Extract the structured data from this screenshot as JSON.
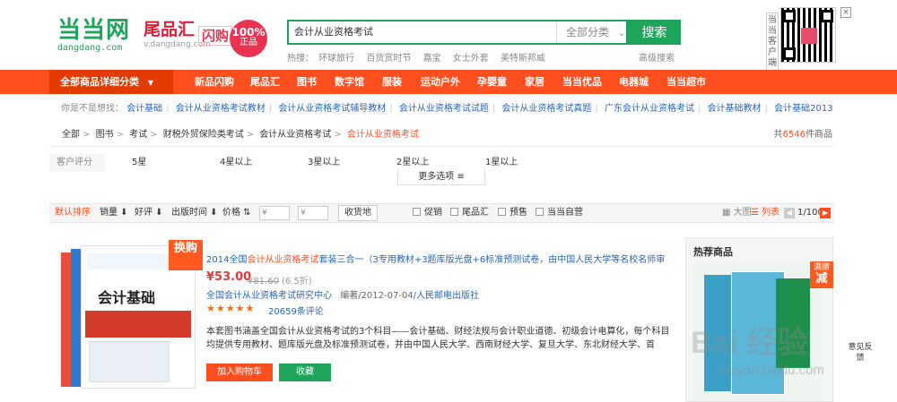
{
  "header": {
    "logo": "当当网",
    "logo_domain": "dangdang.com",
    "brand2": "尾品汇",
    "brand2_domain": "v.dangdang.com",
    "flash": "闪购",
    "badge_top": "100%",
    "badge_bottom": "正品",
    "search_value": "会计从业资格考试",
    "search_category": "全部分类",
    "search_button": "搜索",
    "hot_label": "热搜：",
    "hot_words": [
      "环球旅行",
      "百货赏时节",
      "嘉宝",
      "女士外套",
      "美特斯邦威"
    ],
    "advanced_search": "高级搜索",
    "qr_label": "当当客户端",
    "close_symbol": "×"
  },
  "nav": {
    "all_categories": "全部商品详细分类",
    "items": [
      "新品闪购",
      "尾品汇",
      "图书",
      "数字馆",
      "服装",
      "运动户外",
      "孕婴童",
      "家居",
      "当当优品",
      "电器城",
      "当当超市"
    ]
  },
  "suggest": {
    "label": "你是不是想找：",
    "items": [
      "会计基础",
      "会计从业资格考试教材",
      "会计从业资格考试辅导教材",
      "会计从业资格考试试题",
      "会计从业资格考试真题",
      "广东会计从业资格考试",
      "会计基础教材",
      "会计基础2013"
    ]
  },
  "breadcrumb": {
    "items": [
      "全部",
      "图书",
      "考试",
      "财税外贸保险类考试",
      "会计从业资格考试"
    ],
    "current": "会计从业资格考试",
    "count_prefix": "共",
    "count": "6546",
    "count_suffix": "件商品"
  },
  "rating": {
    "label": "客户评分",
    "options": [
      "5星",
      "4星以上",
      "3星以上",
      "2星以上",
      "1星以上"
    ],
    "more": "更多选项 ≡"
  },
  "filter": {
    "default_sort": "默认排序",
    "sales": "销量",
    "praise": "好评",
    "pub_time": "出版时间",
    "price": "价格",
    "price_from": "¥",
    "price_to": "¥",
    "ship_to": "收货地",
    "promo": "促销",
    "tail": "尾品汇",
    "presale": "预售",
    "self": "当当自营",
    "big_view": "大图",
    "list_view": "列表",
    "page": "1/100"
  },
  "product": {
    "swap_tag": "换购",
    "title_prefix": "2014全国",
    "title_highlight": "会计从业资格考试",
    "title_suffix": "套装三合一（3专用教材+3题库版光盘+6标准预测试卷，由中国人民大学等名校名师审",
    "price": "¥53.00",
    "orig_price": "¥81.60",
    "discount": "(6.5折)",
    "author": "全国会计从业资格考试研究中心",
    "edit_note": "编著",
    "pub_date": "/2012-07-04",
    "publisher": "/人民邮电出版社",
    "stars": "★★★★★",
    "reviews": "20659条评论",
    "description": "本套图书涵盖全国会计从业资格考试的3个科目——会计基础、财经法规与会计职业道德、初级会计电算化，每个科目均提供专用教材、题库版光盘及标准预测试卷，并由中国人民大学、西南财经大学、复旦大学、东北财经大学、首",
    "cart_button": "加入购物车",
    "fav_button": "收藏",
    "book_title": "会计基础"
  },
  "sidebar": {
    "title": "热荐商品",
    "tag_top": "满赠",
    "tag_bottom": "减"
  },
  "feedback": "意见反馈",
  "watermark": "Bai 经验",
  "watermark_sub": "jingyan.baidu.com",
  "colors": {
    "brand_green": "#1fa55b",
    "nav_orange": "#ff4f1f",
    "link_blue": "#2b64b3",
    "price_red": "#e4393c"
  }
}
